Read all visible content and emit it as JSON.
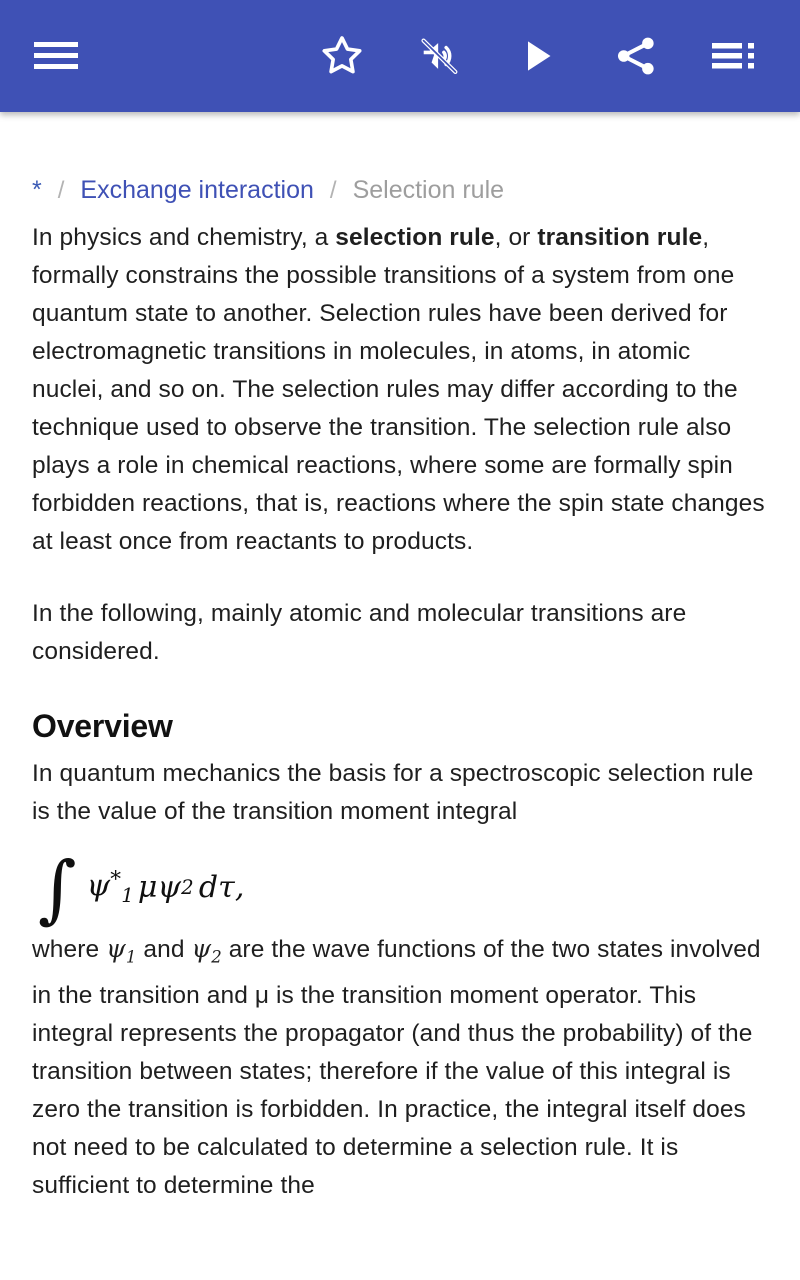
{
  "appbar": {
    "background_color": "#3f51b5",
    "icon_color": "#ffffff",
    "menu_label": "Menu",
    "star_label": "Add to favorites",
    "mute_label": "Text to speech muted",
    "play_label": "Play article",
    "share_label": "Share",
    "contents_label": "Table of contents"
  },
  "breadcrumb": {
    "home": "*",
    "separator": "/",
    "parent": "Exchange interaction",
    "current": "Selection rule",
    "link_color": "#3f51b5",
    "current_color": "#9e9e9e"
  },
  "article": {
    "intro": {
      "lead_1": "In physics and chemistry, a ",
      "bold_1": "selection rule",
      "mid_1": ", or ",
      "bold_2": "transition rule",
      "tail_1": ", formally constrains the possible transitions of a system from one quantum state to another. Selection rules have been derived for electromagnetic transitions in molecules, in atoms, in atomic nuclei, and so on. The selection rules may differ according to the technique used to observe the transition. The selection rule also plays a role in chemical reactions, where some are formally spin forbidden reactions, that is, reactions where the spin state changes at least once from reactants to products."
    },
    "paragraph_2": "In the following, mainly atomic and molecular transitions are considered.",
    "section_overview": {
      "heading": "Overview",
      "paragraph_1": "In quantum mechanics the basis for a spectroscopic selection rule is the value of the transition moment integral",
      "formula": {
        "integral": "∫",
        "psi": "ψ",
        "sub_1": "1",
        "star": "*",
        "mu": "μ",
        "sub_2": "2",
        "d": "d",
        "tau": "τ",
        "comma": ","
      },
      "paragraph_2_a": "where ",
      "paragraph_2_b": " and ",
      "paragraph_2_c": " are the wave functions of the two states involved in the transition and μ is the transition moment operator. This integral represents the propagator (and thus the probability) of the transition between states; therefore if the value of this integral is zero the transition is forbidden. In practice, the integral itself does not need to be calculated to determine a selection rule. It is sufficient to determine the"
    }
  }
}
